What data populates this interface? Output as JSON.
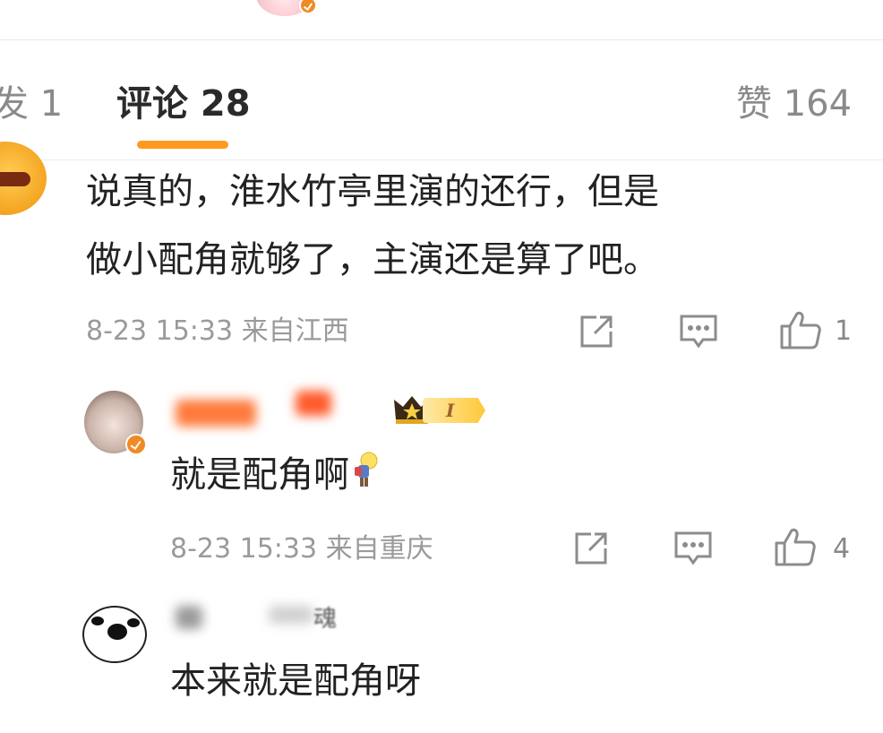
{
  "tabs": {
    "repost": "发 1",
    "comment": "评论 28",
    "like": "赞 164"
  },
  "comment_main": {
    "line1": "说真的，淮水竹亭里演的还行，但是",
    "line2": "做小配角就够了，主演还是算了吧。",
    "meta": "8-23 15:33 来自江西",
    "like_count": "1"
  },
  "reply1": {
    "text": "就是配角啊",
    "level_badge": "I",
    "meta": "8-23 15:33 来自重庆",
    "like_count": "4"
  },
  "reply2": {
    "name_partial": "魂",
    "text": "本来就是配角呀"
  },
  "colors": {
    "accent": "#ff9a1f",
    "verified_badge": "#f08a24",
    "meta_text": "#9a9a9a"
  },
  "icons": [
    "share-icon",
    "comment-icon",
    "like-icon",
    "verified-badge-icon",
    "crown-icon",
    "bulb-emoji-icon"
  ]
}
